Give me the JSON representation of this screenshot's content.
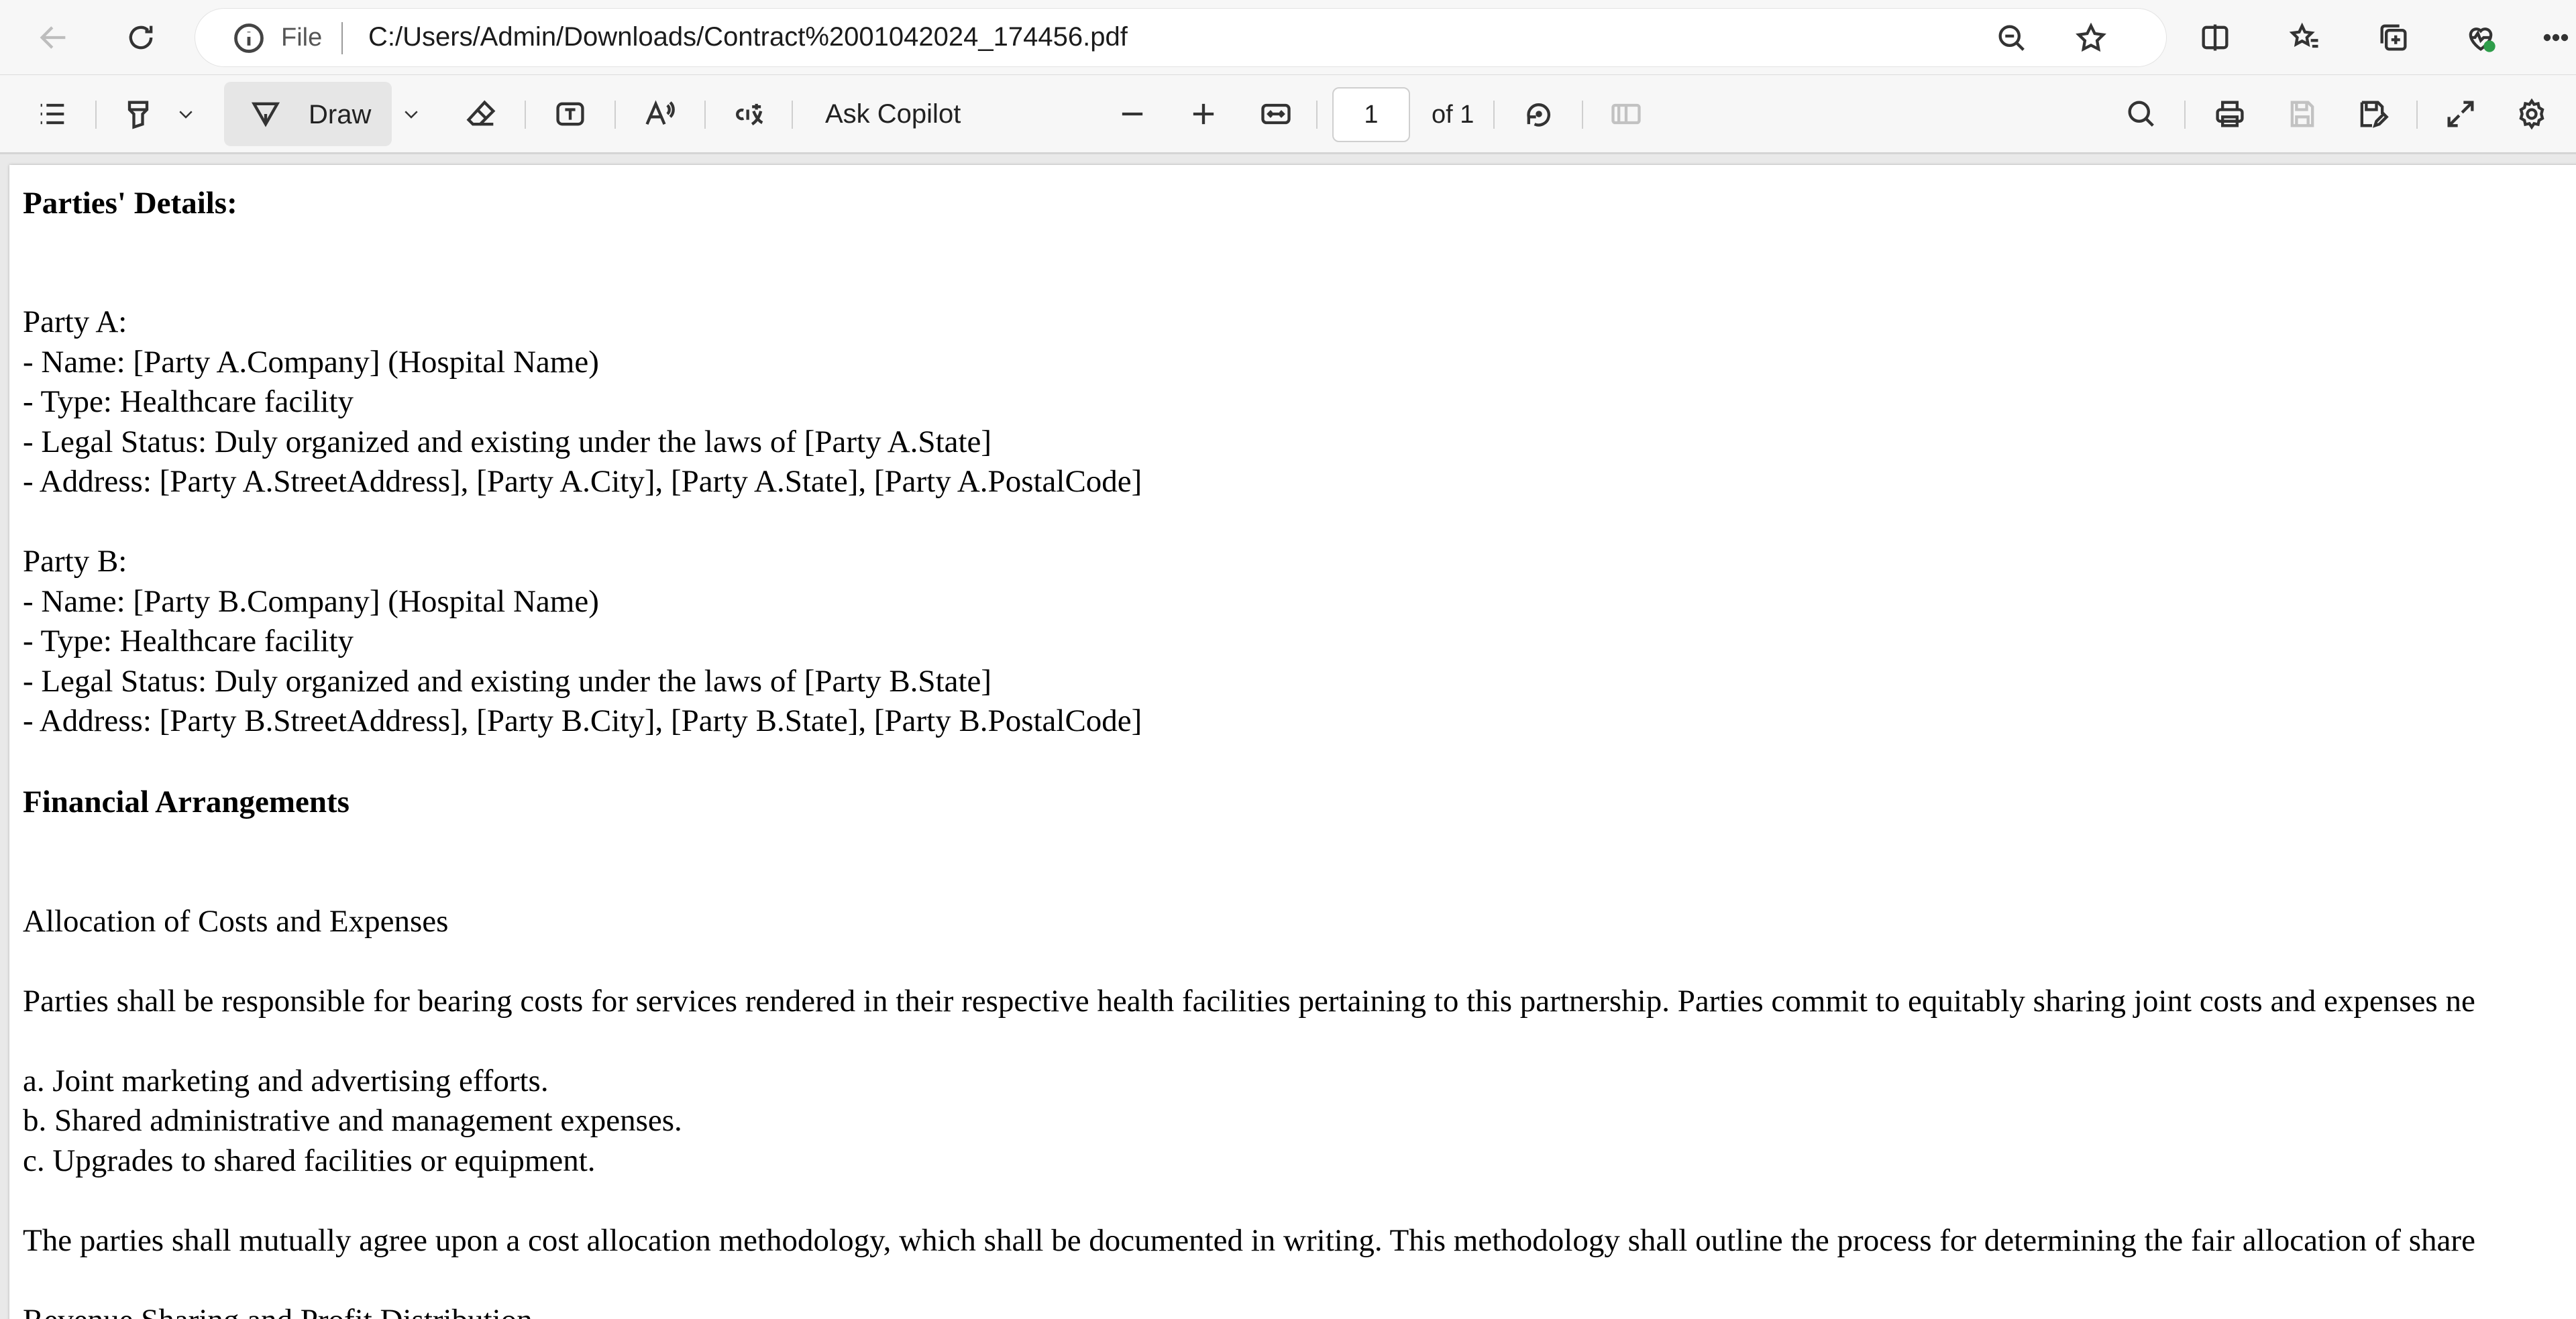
{
  "browser": {
    "address": {
      "scheme_label": "File",
      "url": "C:/Users/Admin/Downloads/Contract%2001042024_174456.pdf"
    }
  },
  "pdf_toolbar": {
    "draw_label": "Draw",
    "ask_copilot_label": "Ask Copilot",
    "page_current": "1",
    "page_total_label": "of 1"
  },
  "document": {
    "lines": [
      {
        "text": "Parties' Details:",
        "bold": true
      },
      {
        "text": "Party A:",
        "bold": false
      },
      {
        "text": "- Name: [Party A.Company] (Hospital Name)",
        "bold": false
      },
      {
        "text": "- Type: Healthcare facility",
        "bold": false
      },
      {
        "text": "- Legal Status: Duly organized and existing under the laws of [Party A.State]",
        "bold": false
      },
      {
        "text": "- Address: [Party A.StreetAddress], [Party A.City], [Party A.State], [Party A.PostalCode]",
        "bold": false
      },
      {
        "text": "Party B:",
        "bold": false
      },
      {
        "text": "- Name: [Party B.Company] (Hospital Name)",
        "bold": false
      },
      {
        "text": "- Type: Healthcare facility",
        "bold": false
      },
      {
        "text": "- Legal Status: Duly organized and existing under the laws of [Party B.State]",
        "bold": false
      },
      {
        "text": "- Address: [Party B.StreetAddress], [Party B.City], [Party B.State], [Party B.PostalCode]",
        "bold": false
      },
      {
        "text": "Financial Arrangements",
        "bold": true
      },
      {
        "text": "Allocation of Costs and Expenses",
        "bold": false
      },
      {
        "text": "Parties shall be responsible for bearing costs for services rendered in their respective health facilities pertaining to this partnership. Parties commit to equitably sharing joint costs and expenses ne",
        "bold": false
      },
      {
        "text": "a. Joint marketing and advertising efforts.",
        "bold": false
      },
      {
        "text": "b. Shared administrative and management expenses.",
        "bold": false
      },
      {
        "text": "c. Upgrades to shared facilities or equipment.",
        "bold": false
      },
      {
        "text": "The parties shall mutually agree upon a cost allocation methodology, which shall be documented in writing. This methodology shall outline the process for determining the fair allocation of share",
        "bold": false
      },
      {
        "text": "Revenue Sharing and Profit Distribution",
        "bold": false
      }
    ]
  }
}
